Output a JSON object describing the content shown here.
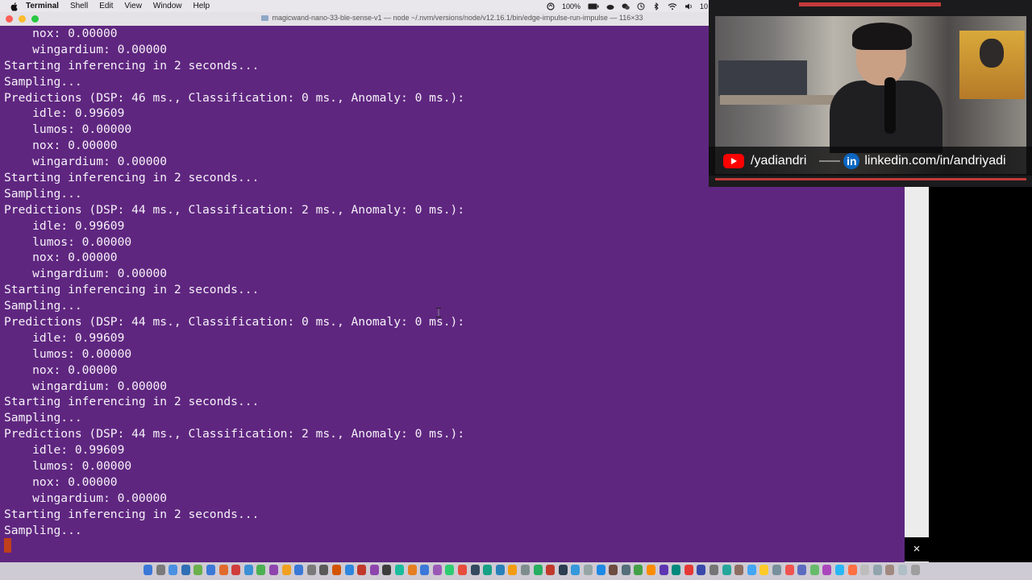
{
  "menubar": {
    "app": "Terminal",
    "menus": [
      "Shell",
      "Edit",
      "View",
      "Window",
      "Help"
    ],
    "battery": "100%",
    "clock_partial": "10"
  },
  "window": {
    "title": "magicwand-nano-33-ble-sense-v1 — node ~/.nvm/versions/node/v12.16.1/bin/edge-impulse-run-impulse — 116×33"
  },
  "terminal": {
    "lines": [
      "    nox: 0.00000",
      "    wingardium: 0.00000",
      "Starting inferencing in 2 seconds...",
      "Sampling...",
      "Predictions (DSP: 46 ms., Classification: 0 ms., Anomaly: 0 ms.):",
      "    idle: 0.99609",
      "    lumos: 0.00000",
      "    nox: 0.00000",
      "    wingardium: 0.00000",
      "Starting inferencing in 2 seconds...",
      "Sampling...",
      "Predictions (DSP: 44 ms., Classification: 2 ms., Anomaly: 0 ms.):",
      "    idle: 0.99609",
      "    lumos: 0.00000",
      "    nox: 0.00000",
      "    wingardium: 0.00000",
      "Starting inferencing in 2 seconds...",
      "Sampling...",
      "Predictions (DSP: 44 ms., Classification: 0 ms., Anomaly: 0 ms.):",
      "    idle: 0.99609",
      "    lumos: 0.00000",
      "    nox: 0.00000",
      "    wingardium: 0.00000",
      "Starting inferencing in 2 seconds...",
      "Sampling...",
      "Predictions (DSP: 44 ms., Classification: 2 ms., Anomaly: 0 ms.):",
      "    idle: 0.99609",
      "    lumos: 0.00000",
      "    nox: 0.00000",
      "    wingardium: 0.00000",
      "Starting inferencing in 2 seconds...",
      "Sampling..."
    ],
    "background": "#5f2680",
    "foreground": "#f5f1f7",
    "cursor_color": "#c0401c"
  },
  "webcam": {
    "youtube_handle": "/yadiandri",
    "linkedin_label": "in",
    "linkedin_url": "linkedin.com/in/andriyadi",
    "youtube_color": "#ff0000",
    "linkedin_color": "#0a66c2"
  },
  "popup": {
    "close_symbol": "×"
  },
  "dock": {
    "icon_colors": [
      "#3b78d8",
      "#7a7a7a",
      "#4a90e2",
      "#2f6fb5",
      "#6ab04c",
      "#3b78d8",
      "#e06a2c",
      "#d03d3d",
      "#3b8fd4",
      "#4cb050",
      "#8e44ad",
      "#f0a020",
      "#3b78d8",
      "#7a7a7a",
      "#5a5a5a",
      "#d35400",
      "#2e86de",
      "#c0392b",
      "#8e44ad",
      "#3d3d3d",
      "#1abc9c",
      "#e67e22",
      "#3b78d8",
      "#9b59b6",
      "#2ecc71",
      "#e74c3c",
      "#34495e",
      "#16a085",
      "#2980b9",
      "#f39c12",
      "#7f8c8d",
      "#27ae60",
      "#c0392b",
      "#2c3e50",
      "#3498db",
      "#95a5a6",
      "#1e88e5",
      "#6d4c41",
      "#546e7a",
      "#43a047",
      "#fb8c00",
      "#5e35b1",
      "#00897b",
      "#e53935",
      "#3949ab",
      "#757575",
      "#26a69a",
      "#8d6e63",
      "#42a5f5",
      "#ffca28",
      "#78909c",
      "#ef5350",
      "#5c6bc0",
      "#66bb6a",
      "#ab47bc",
      "#29b6f6",
      "#ff7043",
      "#bdbdbd",
      "#90a4ae",
      "#a1887f",
      "#b0bec5",
      "#9e9e9e"
    ]
  }
}
